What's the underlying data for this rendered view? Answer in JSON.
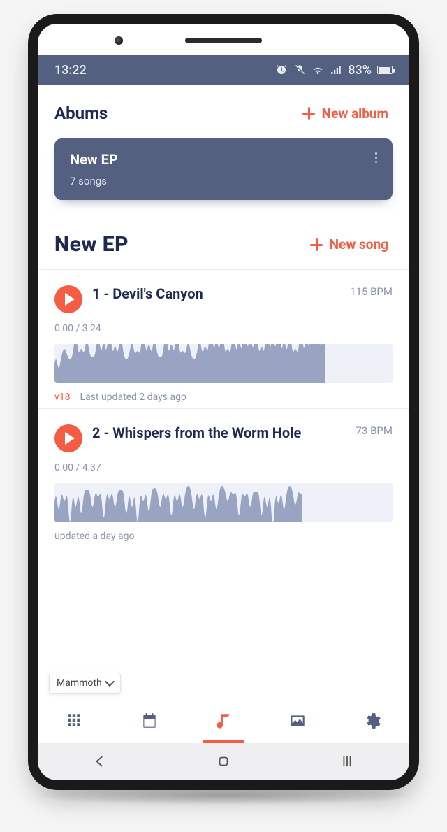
{
  "status": {
    "time": "13:22",
    "battery_text": "83%"
  },
  "albums": {
    "header": "Abums",
    "new_label": "New album",
    "card": {
      "title": "New EP",
      "subtitle": "7 songs"
    }
  },
  "album_detail": {
    "title": "New EP",
    "new_song_label": "New song"
  },
  "songs": [
    {
      "title": "1 - Devil's Canyon",
      "bpm": "115 BPM",
      "time": "0:00 / 3:24",
      "version": "v18",
      "updated": "Last updated 2 days ago"
    },
    {
      "title": "2 - Whispers from the Worm Hole",
      "bpm": "73 BPM",
      "time": "0:00 / 4:37",
      "version": "",
      "updated": "updated a day ago"
    }
  ],
  "dropdown": {
    "label": "Mammoth"
  },
  "tabs": {
    "items": [
      "grid",
      "calendar",
      "music",
      "gallery",
      "settings"
    ],
    "active_index": 2
  }
}
